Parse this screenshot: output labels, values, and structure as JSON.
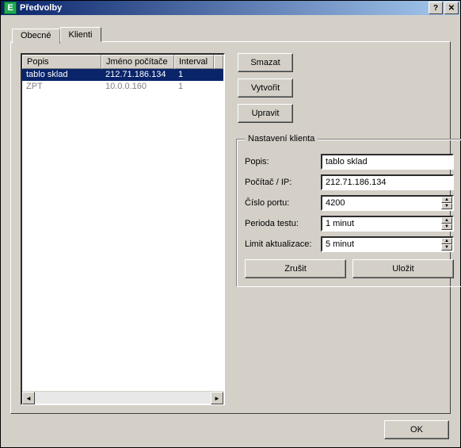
{
  "title": "Předvolby",
  "titlebar_icon_letter": "E",
  "tabs": {
    "general": "Obecné",
    "clients": "Klienti"
  },
  "list": {
    "columns": [
      "Popis",
      "Jméno počítače",
      "Interval"
    ],
    "rows": [
      {
        "popis": "tablo sklad",
        "host": "212.71.186.134",
        "interval": "1",
        "selected": true
      },
      {
        "popis": "ZPT",
        "host": "10.0.0.160",
        "interval": "1",
        "selected": false
      }
    ]
  },
  "buttons": {
    "delete": "Smazat",
    "create": "Vytvořit",
    "edit": "Upravit",
    "cancel": "Zrušit",
    "save": "Uložit",
    "ok": "OK"
  },
  "group": {
    "legend": "Nastavení klienta",
    "fields": {
      "popis_label": "Popis:",
      "popis_value": "tablo sklad",
      "host_label": "Počítač / IP:",
      "host_value": "212.71.186.134",
      "port_label": "Číslo portu:",
      "port_value": "4200",
      "period_label": "Perioda testu:",
      "period_value": "1 minut",
      "limit_label": "Limit aktualizace:",
      "limit_value": "5 minut"
    }
  }
}
